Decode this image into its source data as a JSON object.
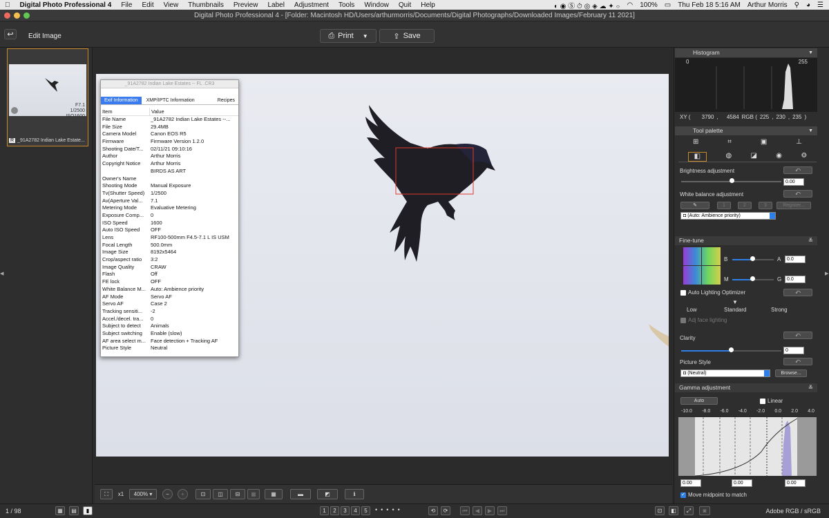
{
  "menubar": {
    "app_name": "Digital Photo Professional 4",
    "items": [
      "File",
      "Edit",
      "View",
      "Thumbnails",
      "Preview",
      "Label",
      "Adjustment",
      "Tools",
      "Window",
      "Quit",
      "Help"
    ],
    "battery": "100%",
    "datetime": "Thu Feb 18  5:16 AM",
    "user": "Arthur Morris"
  },
  "window": {
    "title": "Digital Photo Professional 4 - [Folder: Macintosh HD/Users/arthurmorris/Documents/Digital Photographs/Downloaded Images/February 11 2021]"
  },
  "toolbar": {
    "mode_label": "Edit Image",
    "print_label": "Print",
    "save_label": "Save"
  },
  "thumbnail": {
    "aperture": "F7.1",
    "shutter": "1/2500",
    "iso": "ISO1600",
    "badge": "R",
    "filename": "_91A2782  Indian Lake Estate..."
  },
  "info_window": {
    "title": "_91A2782  Indian Lake Estates -- FL .CR3",
    "tabs": [
      "Exif Information",
      "XMP/IPTC Information",
      "Recipes"
    ],
    "col_item": "Item",
    "col_value": "Value",
    "rows": [
      {
        "k": "File Name",
        "v": "_91A2782  Indian Lake Estates --..."
      },
      {
        "k": "File Size",
        "v": "29.4MB"
      },
      {
        "k": "Camera Model",
        "v": "Canon EOS R5"
      },
      {
        "k": "Firmware",
        "v": "Firmware Version 1.2.0"
      },
      {
        "k": "Shooting Date/T...",
        "v": "02/11/21 09:10:16"
      },
      {
        "k": "Author",
        "v": "Arthur Morris"
      },
      {
        "k": "Copyright Notice",
        "v": "Arthur Morris"
      },
      {
        "k": "",
        "v": "BIRDS AS ART"
      },
      {
        "k": "Owner's Name",
        "v": ""
      },
      {
        "k": "Shooting Mode",
        "v": "Manual Exposure"
      },
      {
        "k": "Tv(Shutter Speed)",
        "v": "1/2500"
      },
      {
        "k": "Av(Aperture Val...",
        "v": "7.1"
      },
      {
        "k": "Metering Mode",
        "v": "Evaluative Metering"
      },
      {
        "k": "Exposure Comp...",
        "v": "0"
      },
      {
        "k": "ISO Speed",
        "v": "1600"
      },
      {
        "k": "Auto ISO Speed",
        "v": "OFF"
      },
      {
        "k": "Lens",
        "v": "RF100-500mm F4.5-7.1 L IS USM"
      },
      {
        "k": "Focal Length",
        "v": "500.0mm"
      },
      {
        "k": "Image Size",
        "v": "8192x5464"
      },
      {
        "k": "Crop/aspect ratio",
        "v": "3:2"
      },
      {
        "k": "Image Quality",
        "v": "CRAW"
      },
      {
        "k": "Flash",
        "v": "Off"
      },
      {
        "k": "FE lock",
        "v": "OFF"
      },
      {
        "k": "White Balance M...",
        "v": "Auto: Ambience priority"
      },
      {
        "k": "AF Mode",
        "v": "Servo AF"
      },
      {
        "k": "Servo AF",
        "v": "Case 2"
      },
      {
        "k": "Tracking sensiti...",
        "v": "-2"
      },
      {
        "k": "Accel./decel. tra...",
        "v": "0"
      },
      {
        "k": "Subject to detect",
        "v": "Animals"
      },
      {
        "k": "Subject switching",
        "v": "Enable (slow)"
      },
      {
        "k": "AF area select m...",
        "v": "Face detection + Tracking AF"
      },
      {
        "k": "Picture Style",
        "v": "Neutral"
      }
    ]
  },
  "histogram": {
    "title": "Histogram",
    "min": "0",
    "max": "255",
    "xy_label": "XY (",
    "x": "3790",
    "y": "4584",
    "rgb_label": "RGB (",
    "r": "225",
    "g": "230",
    "b": "235",
    "close_paren": ")"
  },
  "tool_palette": {
    "title": "Tool palette",
    "brightness_label": "Brightness adjustment",
    "brightness_value": "0.00",
    "brightness_level": 0.5,
    "wb_label": "White balance adjustment",
    "wb_presets": [
      "1",
      "2",
      "3"
    ],
    "register_label": "Register...",
    "wb_selected": "(Auto: Ambience priority)"
  },
  "finetune": {
    "title": "Fine-tune",
    "b_label": "B",
    "a_label": "A",
    "a_value": "0.0",
    "m_label": "M",
    "g_label": "G",
    "g_value": "0.0",
    "alo_label": "Auto Lighting Optimizer",
    "low": "Low",
    "standard": "Standard",
    "strong": "Strong",
    "face_label": "Adj face lighting",
    "clarity_label": "Clarity",
    "clarity_value": "0",
    "ps_label": "Picture Style",
    "ps_selected": "(Neutral)",
    "browse_label": "Browse..."
  },
  "gamma": {
    "title": "Gamma adjustment",
    "auto_label": "Auto",
    "linear_label": "Linear",
    "ticks": [
      "-10.0",
      "-8.0",
      "-6.0",
      "-4.0",
      "-2.0",
      "0.0",
      "2.0",
      "4.0"
    ],
    "v1": "0.00",
    "v2": "0.00",
    "v3": "0.00",
    "midpoint_label": "Move midpoint to match"
  },
  "bottom": {
    "zoom_x1": "x1",
    "zoom_pct": "400%",
    "ratings": [
      "1",
      "2",
      "3",
      "4",
      "5"
    ]
  },
  "status": {
    "count": "1 / 98",
    "colorspace": "Adobe RGB / sRGB"
  },
  "colors": {
    "accent": "#2f7fe8",
    "selection": "#c98a2b",
    "af_box": "#e03a2e"
  }
}
